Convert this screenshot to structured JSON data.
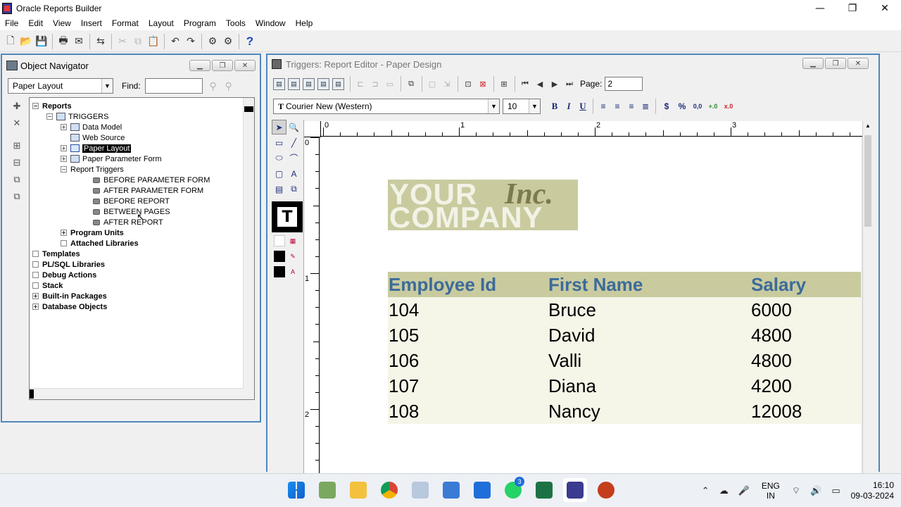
{
  "window": {
    "title": "Oracle Reports Builder",
    "controls": [
      "—",
      "❐",
      "✕"
    ]
  },
  "menu": [
    "File",
    "Edit",
    "View",
    "Insert",
    "Format",
    "Layout",
    "Program",
    "Tools",
    "Window",
    "Help"
  ],
  "navigator": {
    "title": "Object Navigator",
    "view_select": "Paper Layout",
    "find_label": "Find:",
    "find_value": "",
    "tree": [
      {
        "label": "Reports",
        "level": 0,
        "bold": true,
        "expander": "minus"
      },
      {
        "label": "TRIGGERS",
        "level": 1,
        "bold": false,
        "expander": "minus"
      },
      {
        "label": "Data Model",
        "level": 2,
        "expander": "plus"
      },
      {
        "label": "Web Source",
        "level": 2,
        "expander": "none"
      },
      {
        "label": "Paper Layout",
        "level": 2,
        "expander": "plus",
        "selected": true
      },
      {
        "label": "Paper Parameter Form",
        "level": 2,
        "expander": "plus"
      },
      {
        "label": "Report Triggers",
        "level": 2,
        "expander": "minus"
      },
      {
        "label": "BEFORE PARAMETER FORM",
        "level": 3,
        "expander": "none",
        "trigger": true
      },
      {
        "label": "AFTER PARAMETER FORM",
        "level": 3,
        "expander": "none",
        "trigger": true
      },
      {
        "label": "BEFORE REPORT",
        "level": 3,
        "expander": "none",
        "trigger": true
      },
      {
        "label": "BETWEEN PAGES",
        "level": 3,
        "expander": "none",
        "trigger": true
      },
      {
        "label": "AFTER REPORT",
        "level": 3,
        "expander": "none",
        "trigger": true
      },
      {
        "label": "Program Units",
        "level": 2,
        "bold": true,
        "expander": "plus"
      },
      {
        "label": "Attached Libraries",
        "level": 2,
        "bold": true,
        "expander": "empty"
      },
      {
        "label": "Templates",
        "level": 0,
        "bold": true,
        "expander": "empty"
      },
      {
        "label": "PL/SQL Libraries",
        "level": 0,
        "bold": true,
        "expander": "empty"
      },
      {
        "label": "Debug Actions",
        "level": 0,
        "bold": true,
        "expander": "empty"
      },
      {
        "label": "Stack",
        "level": 0,
        "bold": true,
        "expander": "empty"
      },
      {
        "label": "Built-in Packages",
        "level": 0,
        "bold": true,
        "expander": "plus"
      },
      {
        "label": "Database Objects",
        "level": 0,
        "bold": true,
        "expander": "plus"
      }
    ]
  },
  "editor": {
    "title": "Triggers: Report Editor - Paper Design",
    "page_label": "Page:",
    "page_value": "2",
    "font_name": "Courier New (Western)",
    "font_size": "10",
    "ruler_top": [
      "0",
      "1",
      "2",
      "3"
    ],
    "ruler_left": [
      "0",
      "1",
      "2"
    ],
    "logo": {
      "line1": "YOUR",
      "line2": "COMPANY",
      "inc": "Inc."
    },
    "table": {
      "headers": [
        "Employee Id",
        "First Name",
        "Salary"
      ],
      "rows": [
        [
          "104",
          "Bruce",
          "6000"
        ],
        [
          "105",
          "David",
          "4800"
        ],
        [
          "106",
          "Valli",
          "4800"
        ],
        [
          "107",
          "Diana",
          "4200"
        ],
        [
          "108",
          "Nancy",
          "12008"
        ]
      ]
    }
  },
  "taskbar": {
    "whatsapp_badge": "3",
    "lang_line1": "ENG",
    "lang_line2": "IN",
    "time": "16:10",
    "date": "09-03-2024"
  }
}
